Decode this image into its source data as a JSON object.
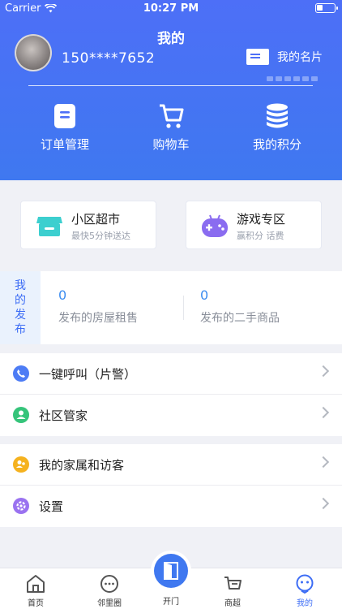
{
  "status_bar": {
    "carrier": "Carrier",
    "time": "10:27 PM"
  },
  "header": {
    "title": "我的"
  },
  "profile": {
    "phone": "150****7652",
    "card_label": "我的名片"
  },
  "quick_actions": [
    {
      "label": "订单管理",
      "icon": "clipboard-icon"
    },
    {
      "label": "购物车",
      "icon": "cart-icon"
    },
    {
      "label": "我的积分",
      "icon": "coins-icon"
    }
  ],
  "promos": [
    {
      "title": "小区超市",
      "subtitle": "最快5分钟送达",
      "icon": "store-icon",
      "color": "#3ccfcf"
    },
    {
      "title": "游戏专区",
      "subtitle": "赢积分 话费",
      "icon": "gamepad-icon",
      "color": "#8a6cf0"
    }
  ],
  "publish": {
    "tag": "我的发布",
    "items": [
      {
        "count": "0",
        "label": "发布的房屋租售"
      },
      {
        "count": "0",
        "label": "发布的二手商品"
      }
    ]
  },
  "menu_group_1": [
    {
      "label": "一键呼叫（片警）",
      "icon": "phone-icon",
      "color": "#4d7cf5"
    },
    {
      "label": "社区管家",
      "icon": "user-icon",
      "color": "#35c47a"
    }
  ],
  "menu_group_2": [
    {
      "label": "我的家属和访客",
      "icon": "family-icon",
      "color": "#f5b21f"
    },
    {
      "label": "设置",
      "icon": "settings-icon",
      "color": "#9a72f0"
    }
  ],
  "tabbar": {
    "items": [
      {
        "label": "首页",
        "icon": "home-icon"
      },
      {
        "label": "邻里圈",
        "icon": "chat-icon"
      },
      {
        "label": "商超",
        "icon": "basket-icon"
      },
      {
        "label": "我的",
        "icon": "profile-icon"
      }
    ],
    "center_label": "开门",
    "active": "我的",
    "accent": "#3d6df5"
  }
}
